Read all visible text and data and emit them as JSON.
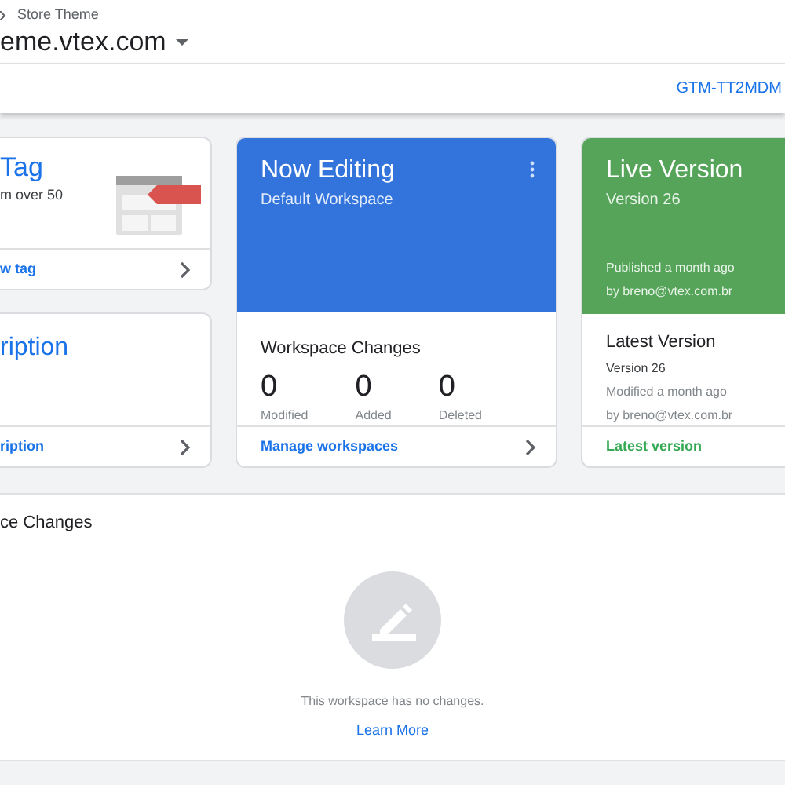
{
  "header": {
    "breadcrumb": "Store Theme",
    "container_name": "eme.vtex.com",
    "container_id": "GTM-TT2MDM"
  },
  "new_tag_card": {
    "title": "Tag",
    "text": "m over 50",
    "link": "w tag"
  },
  "description_card": {
    "title": "ription",
    "link": "ription"
  },
  "now_editing_card": {
    "title": "Now Editing",
    "subtitle": "Default Workspace",
    "section_title": "Workspace Changes",
    "stats": [
      {
        "value": "0",
        "label": "Modified"
      },
      {
        "value": "0",
        "label": "Added"
      },
      {
        "value": "0",
        "label": "Deleted"
      }
    ],
    "link": "Manage workspaces"
  },
  "live_version_card": {
    "title": "Live Version",
    "subtitle": "Version 26",
    "published": "Published a month ago",
    "published_by": "by breno@vtex.com.br",
    "section_title": "Latest Version",
    "version": "Version 26",
    "modified": "Modified a month ago",
    "modified_by": "by breno@vtex.com.br",
    "link": "Latest version"
  },
  "changes_panel": {
    "title": "ce Changes",
    "empty_text": "This workspace has no changes.",
    "link": "Learn More"
  }
}
